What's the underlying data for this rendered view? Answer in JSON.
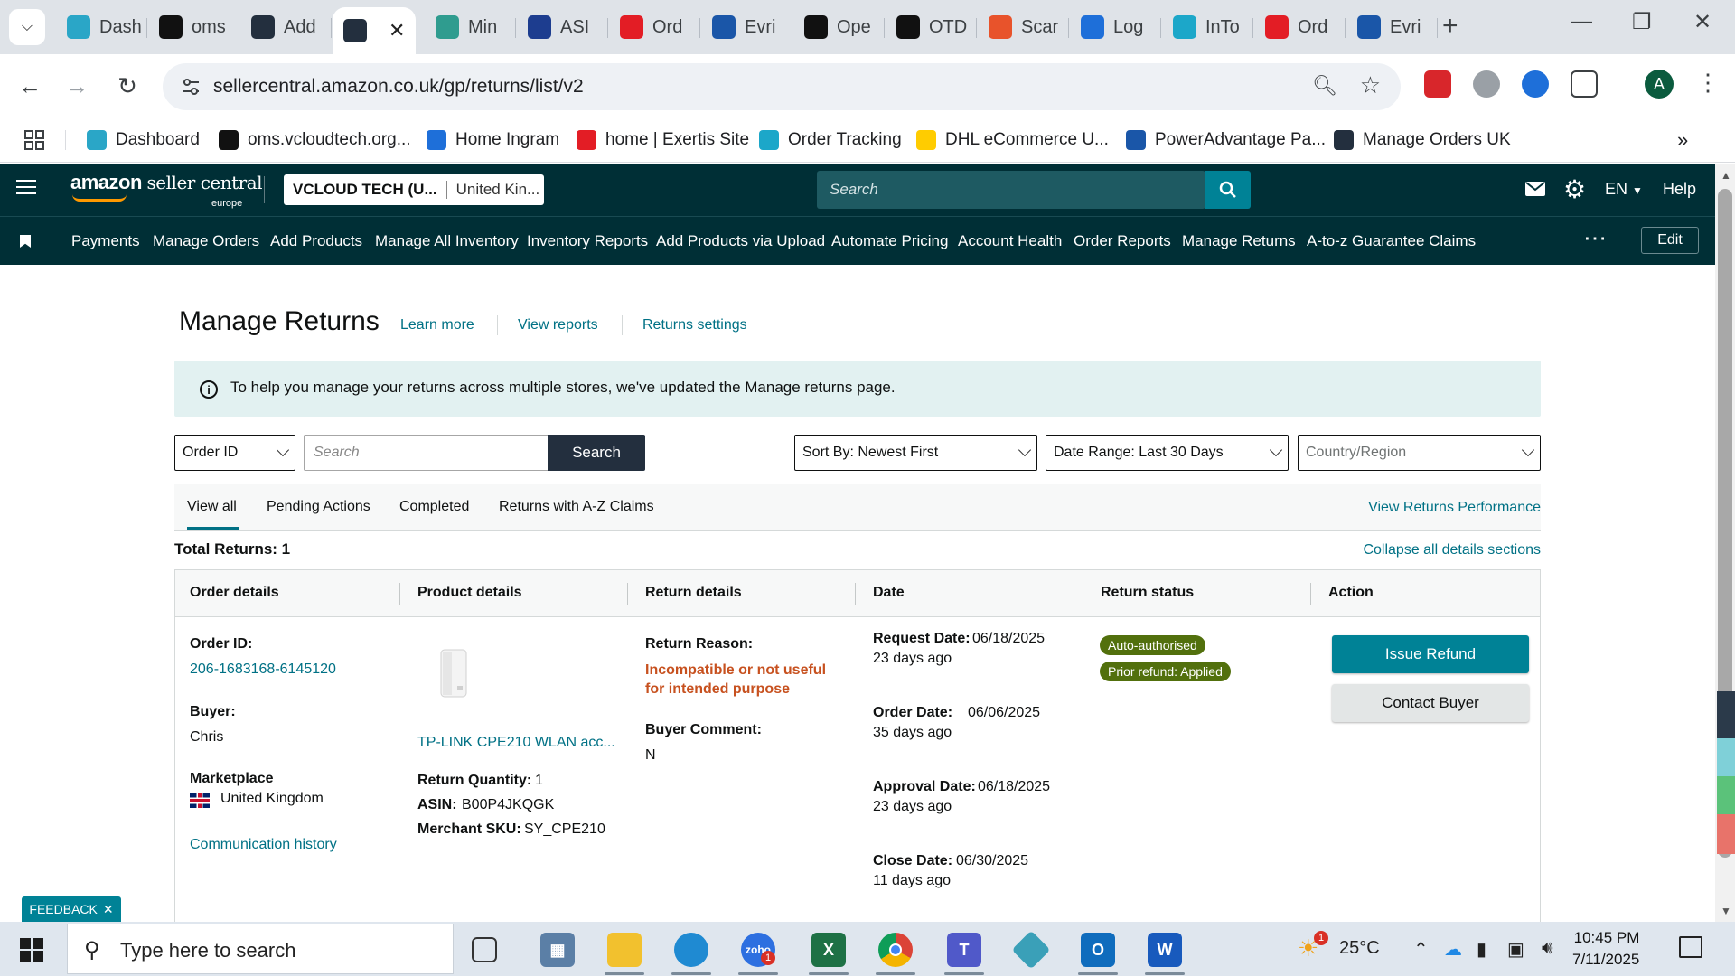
{
  "browser": {
    "tabs": [
      {
        "label": "Dash",
        "icon": "hexagon-icon",
        "color": "#2aa6c7"
      },
      {
        "label": "oms",
        "icon": "triangle-logo-icon",
        "color": "#111111"
      },
      {
        "label": "Add",
        "icon": "amazon-a-icon",
        "color": "#232f3e"
      },
      {
        "label": "",
        "icon": "amazon-a-icon",
        "color": "#232f3e",
        "active": true
      },
      {
        "label": "Min",
        "icon": "mint-icon",
        "color": "#2f9c8f"
      },
      {
        "label": "ASI",
        "icon": "chevron-right-icon",
        "color": "#1d3d8f"
      },
      {
        "label": "Ord",
        "icon": "exertis-icon",
        "color": "#e31d25"
      },
      {
        "label": "Evri",
        "icon": "evri-icon",
        "color": "#1a56a8"
      },
      {
        "label": "Ope",
        "icon": "openai-icon",
        "color": "#111111"
      },
      {
        "label": "OTD",
        "icon": "otd-icon",
        "color": "#111111"
      },
      {
        "label": "Scar",
        "icon": "scan-icon",
        "color": "#e8532b"
      },
      {
        "label": "Log",
        "icon": "login-icon",
        "color": "#1e6fd9"
      },
      {
        "label": "InTo",
        "icon": "into-icon",
        "color": "#1ca7c9"
      },
      {
        "label": "Ord",
        "icon": "exertis-icon",
        "color": "#e31d25"
      },
      {
        "label": "Evri",
        "icon": "evri-icon",
        "color": "#1a56a8"
      }
    ],
    "url": "sellercentral.amazon.co.uk/gp/returns/list/v2",
    "profile_initial": "A",
    "bookmarks": [
      {
        "label": "Dashboard",
        "color": "#2aa6c7"
      },
      {
        "label": "oms.vcloudtech.org...",
        "color": "#111111"
      },
      {
        "label": "Home Ingram",
        "color": "#1e6fd9"
      },
      {
        "label": "home | Exertis Site",
        "color": "#e31d25"
      },
      {
        "label": "Order Tracking",
        "color": "#1ca7c9"
      },
      {
        "label": "DHL eCommerce U...",
        "color": "#ffcc00"
      },
      {
        "label": "PowerAdvantage Pa...",
        "color": "#1a56a8"
      },
      {
        "label": "Manage Orders UK",
        "color": "#232f3e"
      }
    ]
  },
  "seller_central": {
    "logo_main": "amazon",
    "logo_sub": "seller central",
    "logo_region": "europe",
    "account_name": "VCLOUD TECH (U...",
    "account_market": "United Kin...",
    "search_placeholder": "Search",
    "language": "EN",
    "help": "Help",
    "nav_items": [
      "Payments",
      "Manage Orders",
      "Add Products",
      "Manage All Inventory",
      "Inventory Reports",
      "Add Products via Upload",
      "Automate Pricing",
      "Account Health",
      "Order Reports",
      "Manage Returns",
      "A-to-z Guarantee Claims"
    ],
    "edit_label": "Edit"
  },
  "page": {
    "title": "Manage Returns",
    "links": [
      "Learn more",
      "View reports",
      "Returns settings"
    ],
    "info_message": "To help you manage your returns across multiple stores, we've updated the Manage returns page.",
    "filter": {
      "id_type": "Order ID",
      "search_placeholder": "Search",
      "search_button": "Search",
      "sort": "Sort By: Newest First",
      "date_range": "Date Range: Last 30 Days",
      "country_placeholder": "Country/Region"
    },
    "tabs": [
      "View all",
      "Pending Actions",
      "Completed",
      "Returns with A-Z Claims"
    ],
    "active_tab": "View all",
    "view_performance": "View Returns Performance",
    "total_returns": "Total Returns: 1",
    "collapse_link": "Collapse all details sections",
    "columns": [
      "Order details",
      "Product details",
      "Return details",
      "Date",
      "Return status",
      "Action"
    ],
    "row": {
      "order_id_label": "Order ID:",
      "order_id": "206-1683168-6145120",
      "buyer_label": "Buyer:",
      "buyer": "Chris",
      "marketplace_label": "Marketplace",
      "marketplace": "United Kingdom",
      "communication_history": "Communication history",
      "product_name": "TP-LINK CPE210 WLAN acc...",
      "return_quantity_label": "Return Quantity:",
      "return_quantity": "1",
      "asin_label": "ASIN:",
      "asin": "B00P4JKQGK",
      "sku_label": "Merchant SKU:",
      "sku": "SY_CPE210",
      "return_reason_label": "Return Reason:",
      "return_reason": "Incompatible or not useful for intended purpose",
      "buyer_comment_label": "Buyer Comment:",
      "buyer_comment": "N",
      "request_date_label": "Request Date:",
      "request_date": "06/18/2025",
      "request_ago": "23 days ago",
      "order_date_label": "Order Date:",
      "order_date": "06/06/2025",
      "order_ago": "35 days ago",
      "approval_date_label": "Approval Date:",
      "approval_date": "06/18/2025",
      "approval_ago": "23 days ago",
      "close_date_label": "Close Date:",
      "close_date": "06/30/2025",
      "close_ago": "11 days ago",
      "status_badges": [
        "Auto-authorised",
        "Prior refund: Applied"
      ],
      "issue_refund": "Issue Refund",
      "contact_buyer": "Contact Buyer"
    },
    "feedback": "FEEDBACK"
  },
  "taskbar": {
    "search_placeholder": "Type here to search",
    "weather_temp": "25°C",
    "weather_badge": "1",
    "teams_badge": "1",
    "time": "10:45 PM",
    "date": "7/11/2025"
  }
}
